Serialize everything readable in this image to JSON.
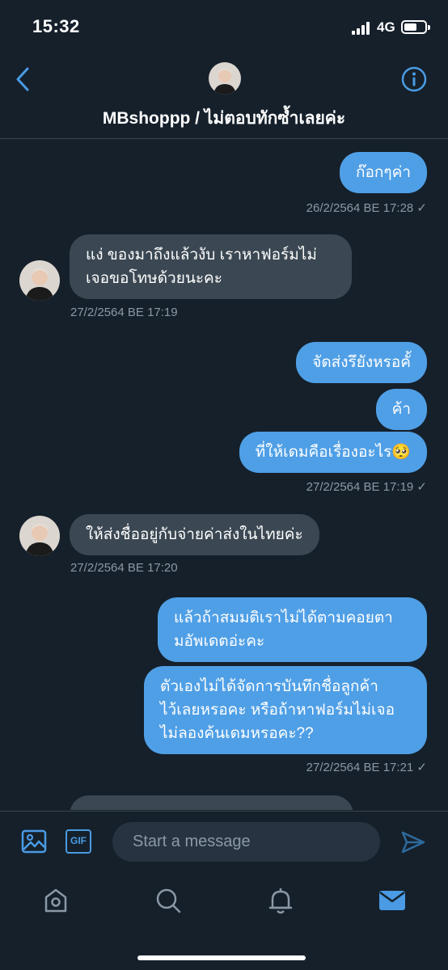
{
  "status_bar": {
    "time": "15:32",
    "network": "4G"
  },
  "header": {
    "title": "MBshoppp / ไม่ตอบทักซ้ำเลยค่ะ"
  },
  "messages": [
    {
      "dir": "sent",
      "text": "ก๊อกๆค่า"
    },
    {
      "ts": "26/2/2564 BE 17:28 ✓"
    },
    {
      "dir": "recv",
      "text_lines": [
        "แง่ ของมาถึงแล้วงับ เราหาฟอร์มไม่",
        "เจอขอโทษด้วยนะคะ"
      ]
    },
    {
      "ts": "27/2/2564 BE 17:19"
    },
    {
      "dir": "sent",
      "text": "จัดส่งรึยังหรอคั้"
    },
    {
      "dir": "sent",
      "text": "ค้า"
    },
    {
      "dir": "sent",
      "text": "ที่ให้เดมคือเรื่องอะไร🥺"
    },
    {
      "ts": "27/2/2564 BE 17:19 ✓"
    },
    {
      "dir": "recv",
      "text": "ให้ส่งชื่ออยู่กับจ่ายค่าส่งในไทยค่ะ"
    },
    {
      "ts": "27/2/2564 BE 17:20"
    },
    {
      "dir": "sent",
      "text_lines": [
        "แล้วถ้าสมมติเราไม่ได้ตามคอยตา",
        "มอัพเดตอ่ะคะ"
      ]
    },
    {
      "dir": "sent",
      "text_lines": [
        "ตัวเองไม่ได้จัดการบันทึกชื่อลูกค้า",
        "ไว้เลยหรอคะ หรือถ้าหาฟอร์มไม่เจอ",
        "ไม่ลองค้นเดมหรอคะ??"
      ]
    },
    {
      "ts": "27/2/2564 BE 17:21 ✓"
    }
  ],
  "composer": {
    "placeholder": "Start a message",
    "gif_label": "GIF"
  },
  "tab_bar": {
    "items": [
      "home-icon",
      "search-icon",
      "notifications-icon",
      "messages-icon"
    ]
  },
  "colors": {
    "background": "#15202b",
    "sent_bubble": "#4f9fe6",
    "recv_bubble": "#3b4853",
    "accent": "#4a9be3",
    "muted": "#8b98a5"
  }
}
